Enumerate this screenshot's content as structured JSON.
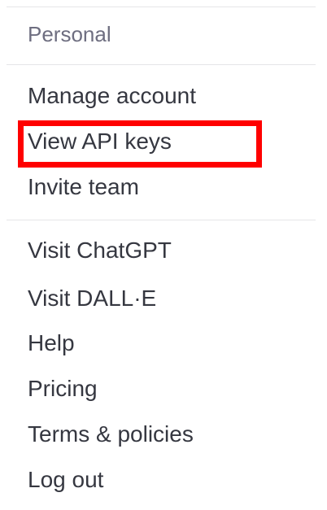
{
  "menu": {
    "section_label": "Personal",
    "group1": [
      {
        "label": "Manage account"
      },
      {
        "label": "View API keys"
      },
      {
        "label": "Invite team"
      }
    ],
    "group2": [
      {
        "label": "Visit ChatGPT"
      },
      {
        "label": "Visit DALL·E"
      },
      {
        "label": "Help"
      },
      {
        "label": "Pricing"
      },
      {
        "label": "Terms & policies"
      },
      {
        "label": "Log out"
      }
    ]
  },
  "colors": {
    "highlight": "#ff0000",
    "text": "#353740",
    "muted": "#6e6e80",
    "divider": "#e5e5e8"
  }
}
